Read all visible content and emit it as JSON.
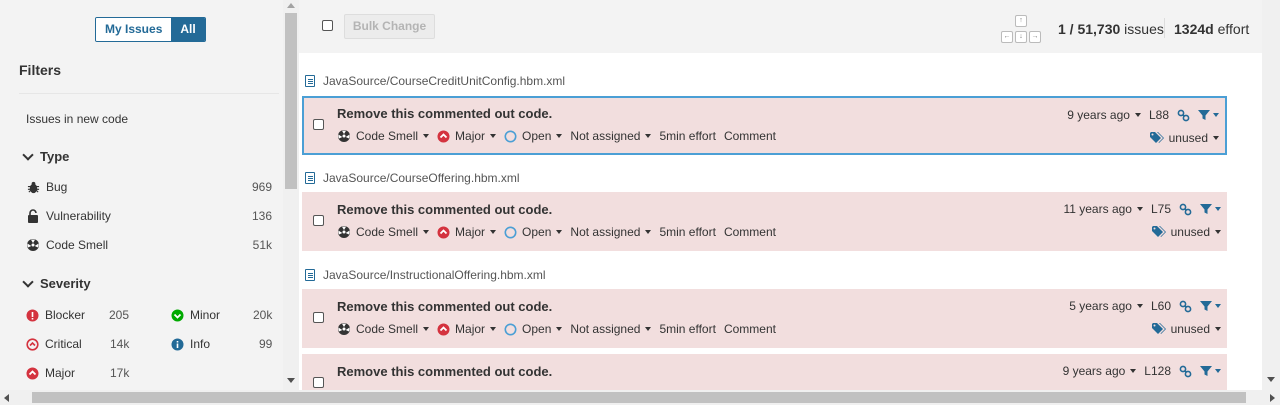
{
  "sidebar": {
    "toggle": {
      "my_issues": "My Issues",
      "all": "All"
    },
    "filters_title": "Filters",
    "new_code_label": "Issues in new code",
    "type": {
      "heading": "Type",
      "items": [
        {
          "label": "Bug",
          "count": "969",
          "icon": "bug-icon"
        },
        {
          "label": "Vulnerability",
          "count": "136",
          "icon": "lock-icon"
        },
        {
          "label": "Code Smell",
          "count": "51k",
          "icon": "code-smell-icon"
        }
      ]
    },
    "severity": {
      "heading": "Severity",
      "items": [
        {
          "label": "Blocker",
          "count": "205",
          "icon": "blocker-icon",
          "color": "#d4333f"
        },
        {
          "label": "Minor",
          "count": "20k",
          "icon": "minor-icon",
          "color": "#00aa00"
        },
        {
          "label": "Critical",
          "count": "14k",
          "icon": "critical-icon",
          "color": "#d4333f"
        },
        {
          "label": "Info",
          "count": "99",
          "icon": "info-icon",
          "color": "#236a97"
        },
        {
          "label": "Major",
          "count": "17k",
          "icon": "major-icon",
          "color": "#d4333f"
        }
      ]
    }
  },
  "toolbar": {
    "bulk_change": "Bulk Change",
    "nav_keys": [
      "↑",
      "←",
      "↓",
      "→"
    ],
    "issue_count": "1 / 51,730",
    "issue_count_suffix": " issues",
    "effort": "1324d",
    "effort_suffix": " effort"
  },
  "files": [
    {
      "path": "JavaSource/CourseCreditUnitConfig.hbm.xml"
    },
    {
      "path": "JavaSource/CourseOffering.hbm.xml"
    },
    {
      "path": "JavaSource/InstructionalOffering.hbm.xml"
    }
  ],
  "issues": [
    {
      "title": "Remove this commented out code.",
      "type": "Code Smell",
      "severity": "Major",
      "status": "Open",
      "assignee": "Not assigned",
      "effort": "5min effort",
      "comment": "Comment",
      "age": "9 years ago",
      "line": "L88",
      "tag": "unused"
    },
    {
      "title": "Remove this commented out code.",
      "type": "Code Smell",
      "severity": "Major",
      "status": "Open",
      "assignee": "Not assigned",
      "effort": "5min effort",
      "comment": "Comment",
      "age": "11 years ago",
      "line": "L75",
      "tag": "unused"
    },
    {
      "title": "Remove this commented out code.",
      "type": "Code Smell",
      "severity": "Major",
      "status": "Open",
      "assignee": "Not assigned",
      "effort": "5min effort",
      "comment": "Comment",
      "age": "5 years ago",
      "line": "L60",
      "tag": "unused"
    },
    {
      "title": "Remove this commented out code.",
      "age": "9 years ago",
      "line": "L128"
    }
  ],
  "colors": {
    "accent": "#236a97",
    "issue_bg": "#f2dede",
    "selected_border": "#4b9fd5",
    "severity_red": "#d4333f"
  }
}
